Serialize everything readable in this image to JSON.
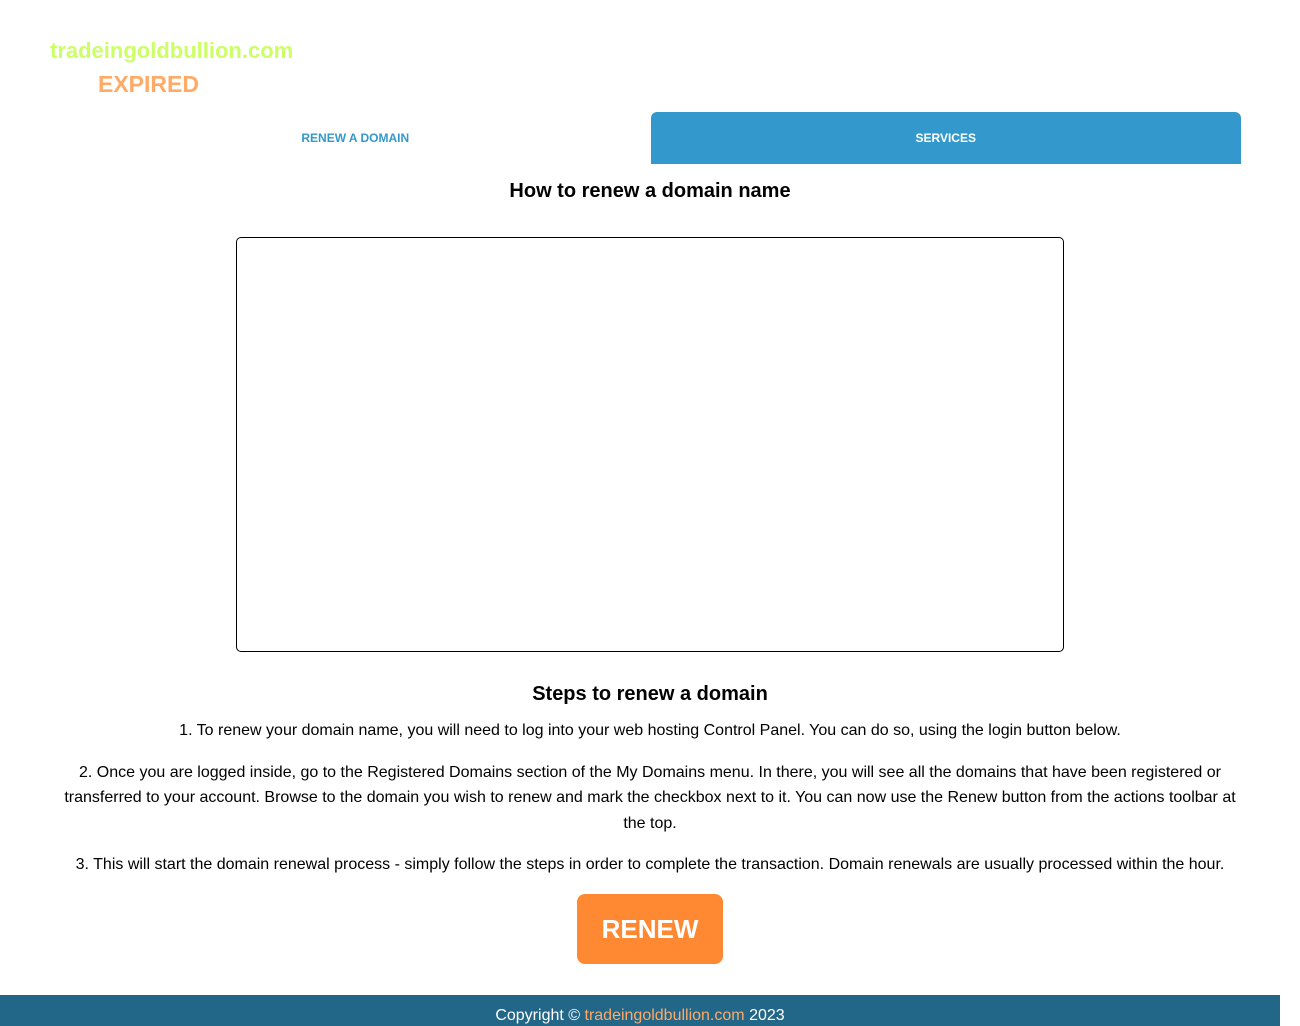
{
  "header": {
    "domain": "tradeingoldbullion.com",
    "status": "EXPIRED"
  },
  "tabs": [
    {
      "label": "RENEW A DOMAIN",
      "active": false
    },
    {
      "label": "SERVICES",
      "active": true
    }
  ],
  "main": {
    "title": "How to renew a domain name",
    "steps_title": "Steps to renew a domain",
    "steps": [
      "1. To renew your domain name, you will need to log into your web hosting Control Panel. You can do so, using the login button below.",
      "2. Once you are logged inside, go to the Registered Domains section of the My Domains menu. In there, you will see all the domains that have been registered or transferred to your account. Browse to the domain you wish to renew and mark the checkbox next to it. You can now use the Renew button from the actions toolbar at the top.",
      "3. This will start the domain renewal process - simply follow the steps in order to complete the transaction. Domain renewals are usually processed within the hour."
    ],
    "renew_button": "RENEW"
  },
  "footer": {
    "prefix": "Copyright ©",
    "domain": "tradeingoldbullion.com",
    "year": "2023"
  },
  "colors": {
    "domain_text": "#ccff66",
    "status_text": "#ffaa66",
    "tab_accent": "#3399cc",
    "button": "#ff8833",
    "footer_bg": "#226688"
  }
}
